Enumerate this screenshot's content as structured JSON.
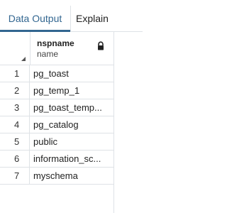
{
  "tabs": [
    {
      "label": "Data Output",
      "active": true
    },
    {
      "label": "Explain",
      "active": false
    }
  ],
  "grid": {
    "columns": [
      {
        "name": "nspname",
        "type": "name",
        "icon": "lock-icon"
      }
    ],
    "rows": [
      {
        "num": "1",
        "nspname": "pg_toast"
      },
      {
        "num": "2",
        "nspname": "pg_temp_1"
      },
      {
        "num": "3",
        "nspname": "pg_toast_temp..."
      },
      {
        "num": "4",
        "nspname": "pg_catalog"
      },
      {
        "num": "5",
        "nspname": "public"
      },
      {
        "num": "6",
        "nspname": "information_sc..."
      },
      {
        "num": "7",
        "nspname": "myschema"
      }
    ]
  },
  "colors": {
    "accent": "#326690",
    "border": "#dee2e6",
    "text": "#222222"
  }
}
